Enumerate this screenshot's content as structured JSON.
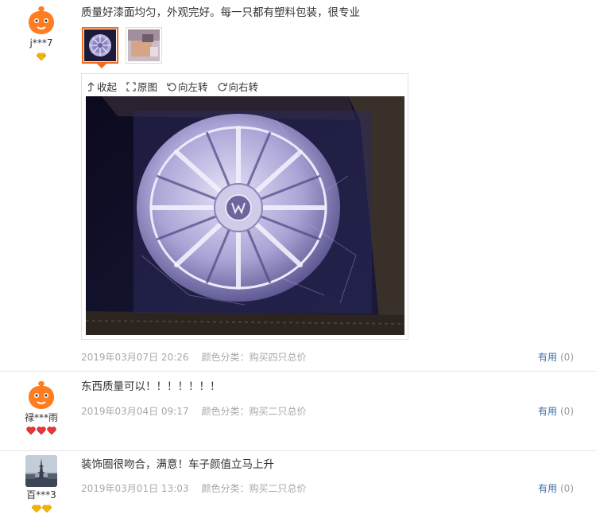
{
  "reviews": [
    {
      "user": "j***7",
      "text": "质量好漆面均匀，外观完好。每一只都有塑料包装，很专业",
      "date": "2019年03月07日 20:26",
      "category": "颜色分类：购买四只总价",
      "useful_label": "有用",
      "useful_count": "(0)",
      "level_icon": "yellow-diamond-icon",
      "level_count": 1
    },
    {
      "user": "禄***雨",
      "text": "东西质量可以！！！！！！！",
      "date": "2019年03月04日 09:17",
      "category": "颜色分类：购买二只总价",
      "useful_label": "有用",
      "useful_count": "(0)",
      "level_icon": "red-heart-icon",
      "level_count": 3
    },
    {
      "user": "百***3",
      "text": "装饰圈很吻合，满意！车子颜值立马上升",
      "date": "2019年03月01日 13:03",
      "category": "颜色分类：购买二只总价",
      "useful_label": "有用",
      "useful_count": "(0)",
      "level_icon": "yellow-diamond-icon",
      "level_count": 2
    }
  ],
  "viewer": {
    "collapse_label": "收起",
    "original_label": "原图",
    "rotate_left_label": "向左转",
    "rotate_right_label": "向右转"
  },
  "colors": {
    "accent_orange": "#f36b16",
    "link_blue": "#3e6ea8",
    "meta_gray": "#a8a8a8"
  }
}
